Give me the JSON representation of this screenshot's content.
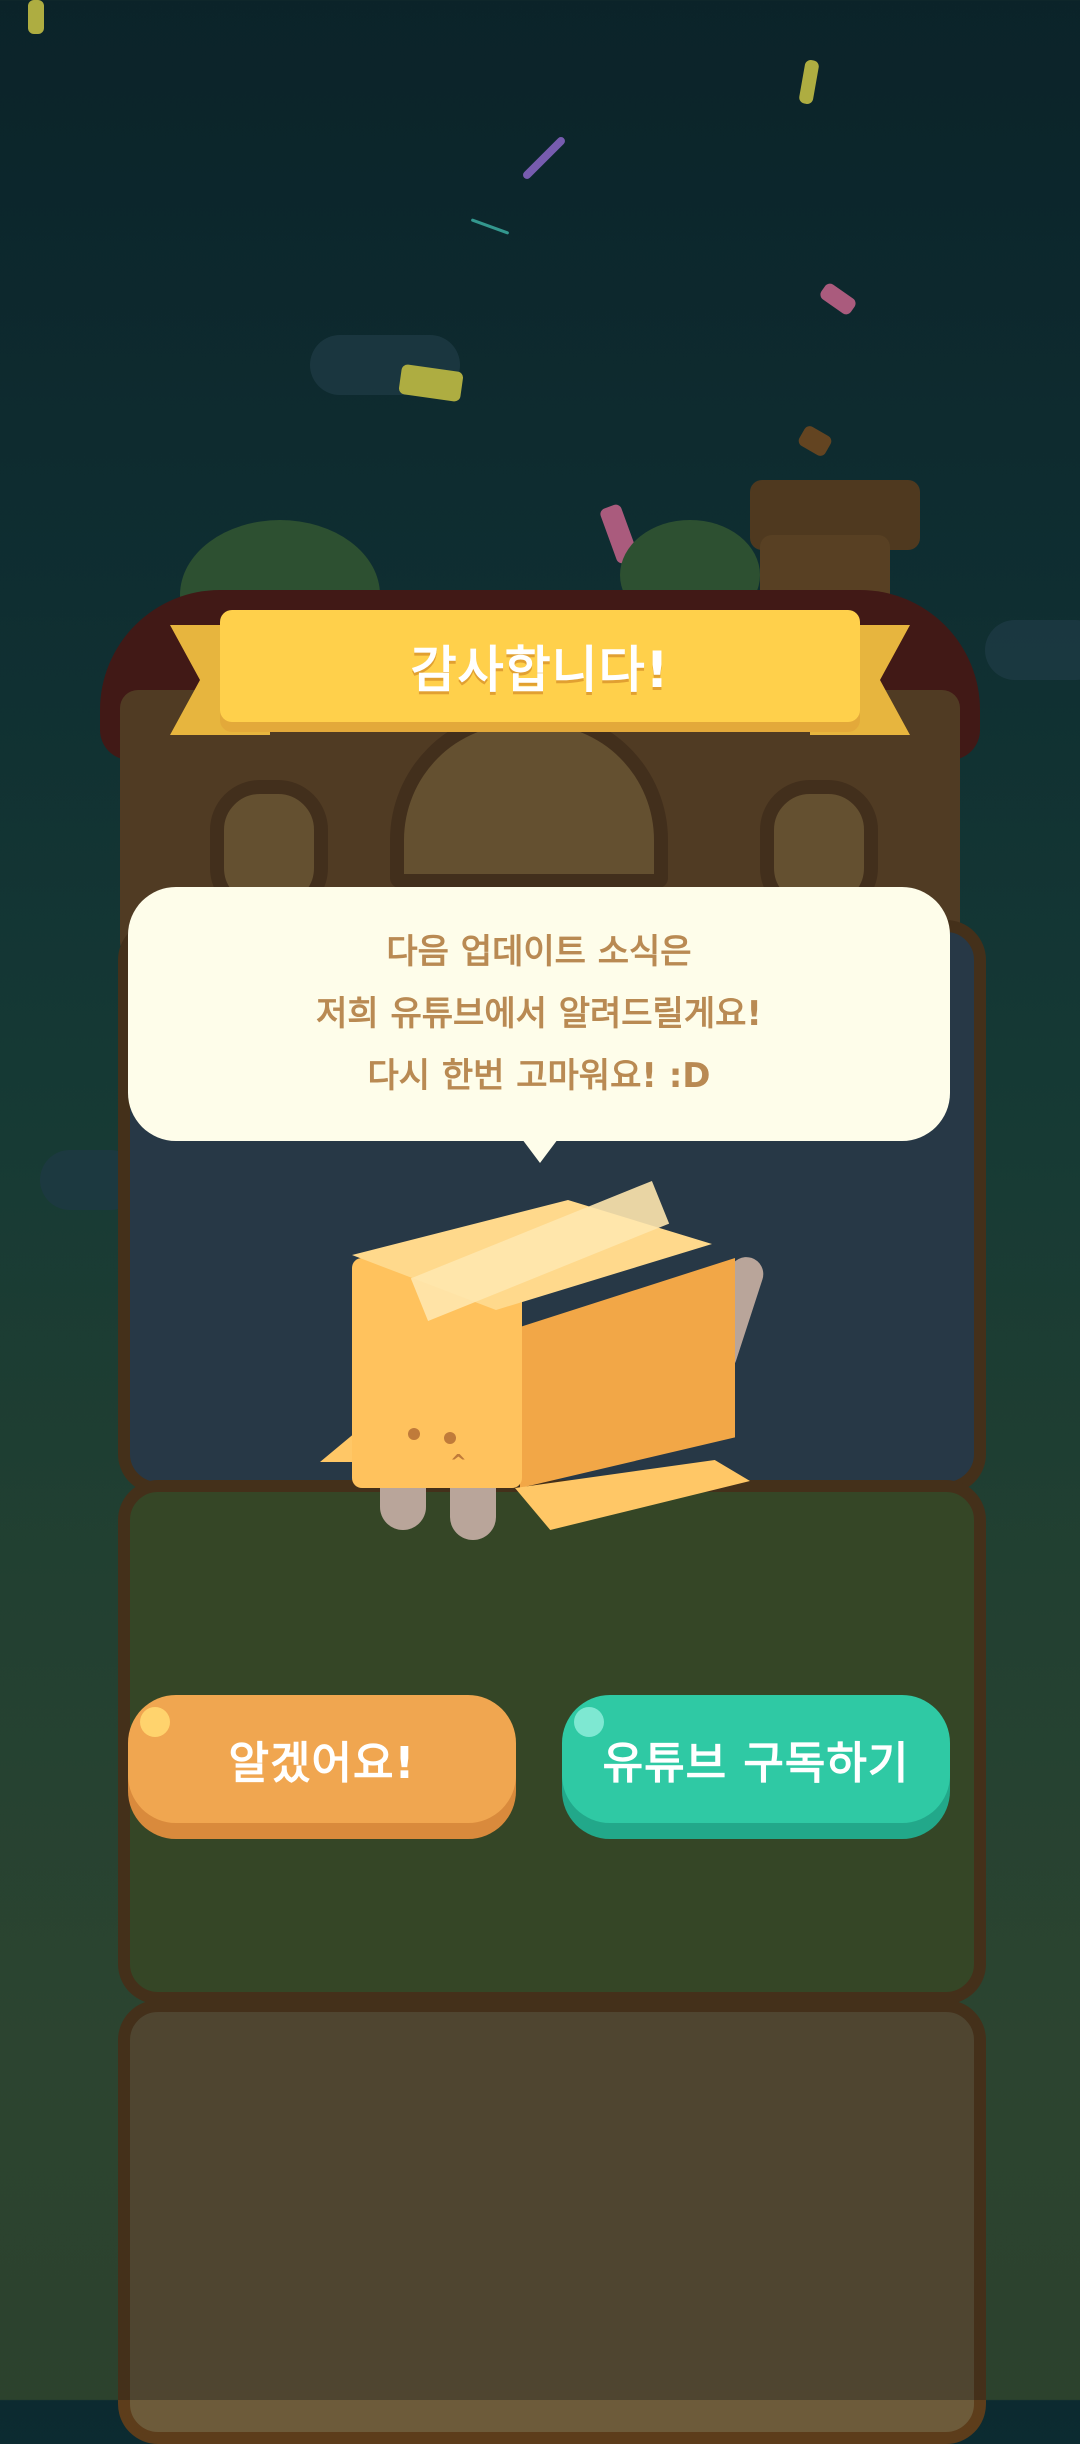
{
  "banner": {
    "title": "감사합니다!"
  },
  "dialog": {
    "lines": [
      "다음 업데이트 소식은",
      "저희 유튜브에서 알려드릴게요!",
      "다시 한번 고마워요! :D"
    ]
  },
  "buttons": {
    "ok_label": "알겠어요!",
    "subscribe_label": "유튜브 구독하기"
  },
  "colors": {
    "banner": "#ffd04b",
    "bubble_bg": "#fefdea",
    "bubble_text": "#b98a53",
    "ok_button": "#f0a650",
    "subscribe_button": "#2fc9a4"
  }
}
